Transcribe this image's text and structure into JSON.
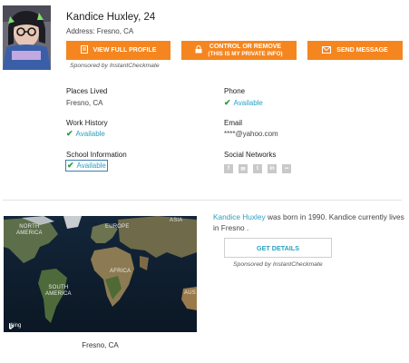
{
  "profile": {
    "name": "Kandice Huxley",
    "age": "24",
    "address": "Address: Fresno, CA"
  },
  "actions": {
    "view_profile": "VIEW FULL PROFILE",
    "control_remove": "CONTROL OR REMOVE",
    "control_remove_sub": "(This is My Private Info)",
    "send_message": "SEND MESSAGE",
    "sponsored": "Sponsored by InstantCheckmate"
  },
  "fields": {
    "places_lived_label": "Places Lived",
    "places_lived_value": "Fresno, CA",
    "phone_label": "Phone",
    "phone_value": "Available",
    "work_label": "Work History",
    "work_value": "Available",
    "email_label": "Email",
    "email_value": "****@yahoo.com",
    "school_label": "School Information",
    "school_value": "Available",
    "social_label": "Social Networks"
  },
  "social_icons": [
    "facebook-icon",
    "email-icon",
    "twitter-icon",
    "linkedin-icon",
    "myspace-icon"
  ],
  "map": {
    "labels": {
      "north_america": "NORTH\nAMERICA",
      "europe": "EUROPE",
      "asia": "ASIA",
      "africa": "AFRICA",
      "south_america": "SOUTH\nAMERICA",
      "aus": "AUS"
    },
    "brand": "bing",
    "caption": "Fresno, CA"
  },
  "details": {
    "name_link": "Kandice Huxley",
    "text": " was born in 1990. Kandice currently lives in Fresno .",
    "button": "GET DETAILS",
    "sponsored": "Sponsored by InstantCheckmate"
  },
  "colors": {
    "accent": "#f5861f",
    "link": "#2aa1c2",
    "check": "#2c9c3f"
  }
}
